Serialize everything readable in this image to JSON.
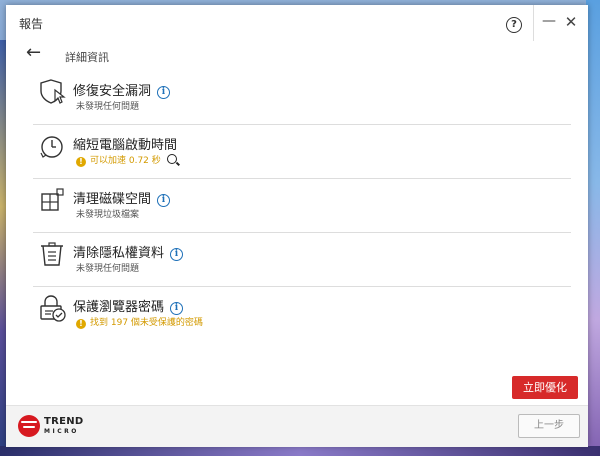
{
  "window": {
    "title": "報告",
    "help_label": "?",
    "minimize_label": "—",
    "close_label": "✕"
  },
  "nav": {
    "back_label": "←",
    "title": "詳細資訊"
  },
  "items": [
    {
      "title": "修復安全漏洞",
      "status": "未發現任何問題",
      "status_type": "ok",
      "icon": "shield-cursor-icon"
    },
    {
      "title": "縮短電腦啟動時間",
      "status": "可以加速 0.72 秒",
      "status_type": "warning",
      "icon": "stopwatch-icon"
    },
    {
      "title": "清理磁碟空間",
      "status": "未發現垃圾檔案",
      "status_type": "ok",
      "icon": "disk-grid-icon"
    },
    {
      "title": "清除隱私權資料",
      "status": "未發現任何問題",
      "status_type": "ok",
      "icon": "trash-bin-icon"
    },
    {
      "title": "保護瀏覽器密碼",
      "status": "找到 197 個未受保護的密碼",
      "status_type": "warning",
      "icon": "lock-check-icon"
    }
  ],
  "actions": {
    "optimize_label": "立即優化",
    "prev_label": "上一步"
  },
  "brand": {
    "line1": "TREND",
    "line2": "MICRO"
  },
  "colors": {
    "accent_red": "#d72a2a",
    "warning": "#d39a00",
    "info_blue": "#1e70b8"
  }
}
